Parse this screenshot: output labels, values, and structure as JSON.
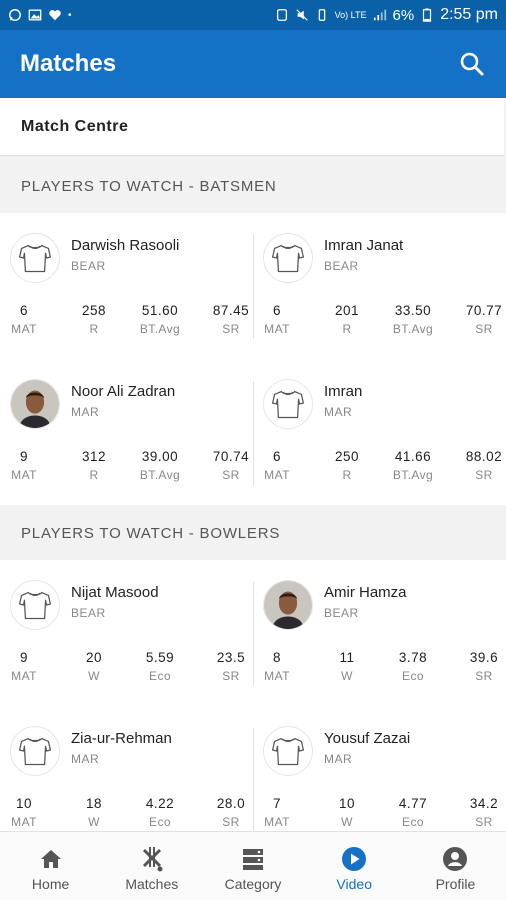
{
  "status": {
    "battery": "6%",
    "time": "2:55 pm",
    "volte": "Vo) LTE"
  },
  "appbar": {
    "title": "Matches"
  },
  "sub_header": {
    "label": "Match Centre"
  },
  "batsmen": {
    "title": "PLAYERS TO WATCH - BATSMEN",
    "players": [
      {
        "name": "Darwish Rasooli",
        "team": "BEAR",
        "avatar": "jersey-icon",
        "stats": [
          {
            "v": "6",
            "l": "MAT"
          },
          {
            "v": "258",
            "l": "R"
          },
          {
            "v": "51.60",
            "l": "BT.Avg"
          },
          {
            "v": "87.45",
            "l": "SR"
          }
        ]
      },
      {
        "name": "Imran Janat",
        "team": "BEAR",
        "avatar": "jersey-icon",
        "stats": [
          {
            "v": "6",
            "l": "MAT"
          },
          {
            "v": "201",
            "l": "R"
          },
          {
            "v": "33.50",
            "l": "BT.Avg"
          },
          {
            "v": "70.77",
            "l": "SR"
          }
        ]
      },
      {
        "name": "Noor Ali Zadran",
        "team": "MAR",
        "avatar": "photo",
        "stats": [
          {
            "v": "9",
            "l": "MAT"
          },
          {
            "v": "312",
            "l": "R"
          },
          {
            "v": "39.00",
            "l": "BT.Avg"
          },
          {
            "v": "70.74",
            "l": "SR"
          }
        ]
      },
      {
        "name": "Imran",
        "team": "MAR",
        "avatar": "jersey-icon",
        "stats": [
          {
            "v": "6",
            "l": "MAT"
          },
          {
            "v": "250",
            "l": "R"
          },
          {
            "v": "41.66",
            "l": "BT.Avg"
          },
          {
            "v": "88.02",
            "l": "SR"
          }
        ]
      }
    ]
  },
  "bowlers": {
    "title": "PLAYERS TO WATCH - BOWLERS",
    "players": [
      {
        "name": "Nijat Masood",
        "team": "BEAR",
        "avatar": "jersey-icon",
        "stats": [
          {
            "v": "9",
            "l": "MAT"
          },
          {
            "v": "20",
            "l": "W"
          },
          {
            "v": "5.59",
            "l": "Eco"
          },
          {
            "v": "23.5",
            "l": "SR"
          }
        ]
      },
      {
        "name": "Amir Hamza",
        "team": "BEAR",
        "avatar": "photo",
        "stats": [
          {
            "v": "8",
            "l": "MAT"
          },
          {
            "v": "11",
            "l": "W"
          },
          {
            "v": "3.78",
            "l": "Eco"
          },
          {
            "v": "39.6",
            "l": "SR"
          }
        ]
      },
      {
        "name": "Zia-ur-Rehman",
        "team": "MAR",
        "avatar": "jersey-icon",
        "stats": [
          {
            "v": "10",
            "l": "MAT"
          },
          {
            "v": "18",
            "l": "W"
          },
          {
            "v": "4.22",
            "l": "Eco"
          },
          {
            "v": "28.0",
            "l": "SR"
          }
        ]
      },
      {
        "name": "Yousuf Zazai",
        "team": "MAR",
        "avatar": "jersey-icon",
        "stats": [
          {
            "v": "7",
            "l": "MAT"
          },
          {
            "v": "10",
            "l": "W"
          },
          {
            "v": "4.77",
            "l": "Eco"
          },
          {
            "v": "34.2",
            "l": "SR"
          }
        ]
      }
    ]
  },
  "bottom_nav": {
    "items": [
      {
        "label": "Home",
        "icon": "home-icon"
      },
      {
        "label": "Matches",
        "icon": "cricket-icon"
      },
      {
        "label": "Category",
        "icon": "category-icon"
      },
      {
        "label": "Video",
        "icon": "play-icon",
        "active": true
      },
      {
        "label": "Profile",
        "icon": "profile-icon"
      }
    ]
  },
  "colors": {
    "statusbar": "#0a61a8",
    "appbar": "#1471c5",
    "accent": "#1471c5"
  }
}
